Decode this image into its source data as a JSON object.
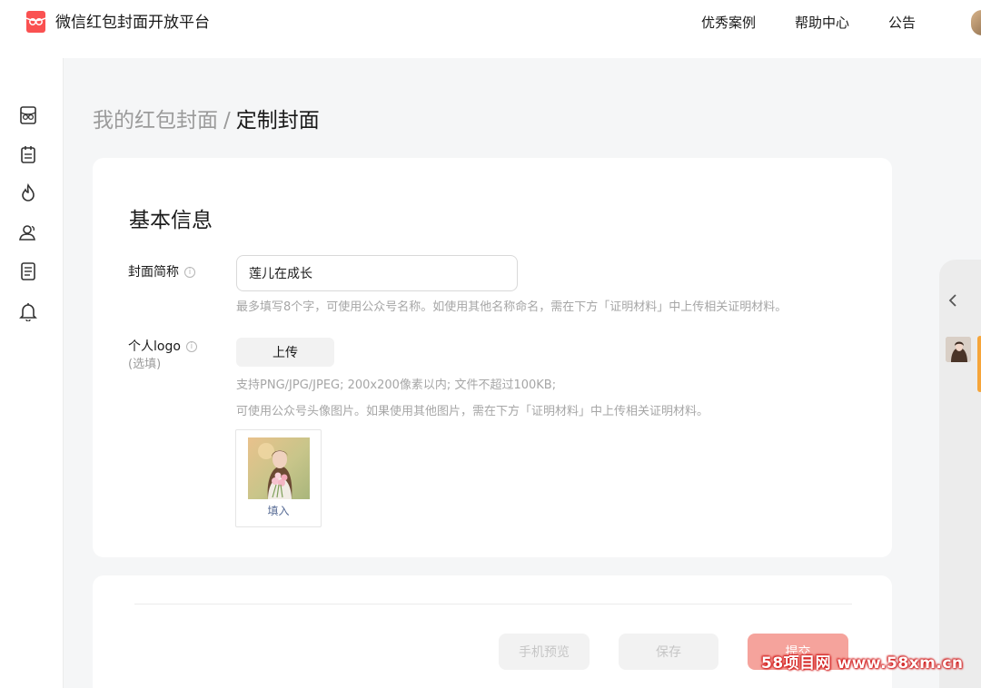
{
  "header": {
    "brand": "微信红包封面开放平台",
    "nav": [
      "优秀案例",
      "帮助中心",
      "公告"
    ]
  },
  "sidebar": {
    "icons": [
      "cover-icon",
      "calendar-icon",
      "fire-icon",
      "users-icon",
      "document-icon",
      "bell-icon"
    ]
  },
  "breadcrumb": {
    "parent": "我的红包封面",
    "separator": "/",
    "current": "定制封面"
  },
  "basic_info": {
    "title": "基本信息",
    "cover_name": {
      "label": "封面简称",
      "value": "莲儿在成长",
      "hint": "最多填写8个字，可使用公众号名称。如使用其他名称命名，需在下方「证明材料」中上传相关证明材料。"
    },
    "personal_logo": {
      "label": "个人logo",
      "optional": "(选填)",
      "upload_label": "上传",
      "hint_line1": "支持PNG/JPG/JPEG; 200x200像素以内; 文件不超过100KB;",
      "hint_line2": "可使用公众号头像图片。如果使用其他图片，需在下方「证明材料」中上传相关证明材料。",
      "fill_label": "填入"
    }
  },
  "actions": {
    "preview": "手机预览",
    "save": "保存",
    "submit": "提交"
  },
  "watermark": "58项目网 www.58xm.cn",
  "colors": {
    "accent": "#fa5151",
    "link": "#576b95",
    "panel_accent": "#f6a53a"
  }
}
